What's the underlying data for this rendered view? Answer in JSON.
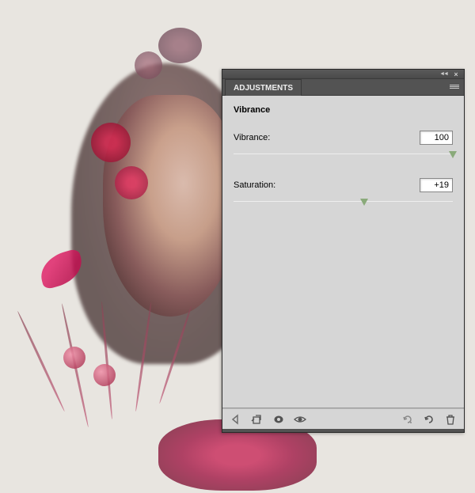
{
  "panel": {
    "tab_label": "ADJUSTMENTS",
    "title": "Vibrance",
    "sliders": [
      {
        "label": "Vibrance:",
        "value": "100",
        "position_pct": 100
      },
      {
        "label": "Saturation:",
        "value": "+19",
        "position_pct": 59.5
      }
    ],
    "footer_icons": {
      "back": "back-icon",
      "clip": "clip-to-layer-icon",
      "view": "toggle-visibility-icon",
      "view_prev": "view-previous-icon",
      "reset_warn": "reset-warn-icon",
      "reset": "reset-icon",
      "trash": "trash-icon"
    },
    "colors": {
      "panel_bg": "#d6d6d6",
      "panel_chrome": "#535353",
      "slider_thumb": "#8aaa7a"
    }
  }
}
